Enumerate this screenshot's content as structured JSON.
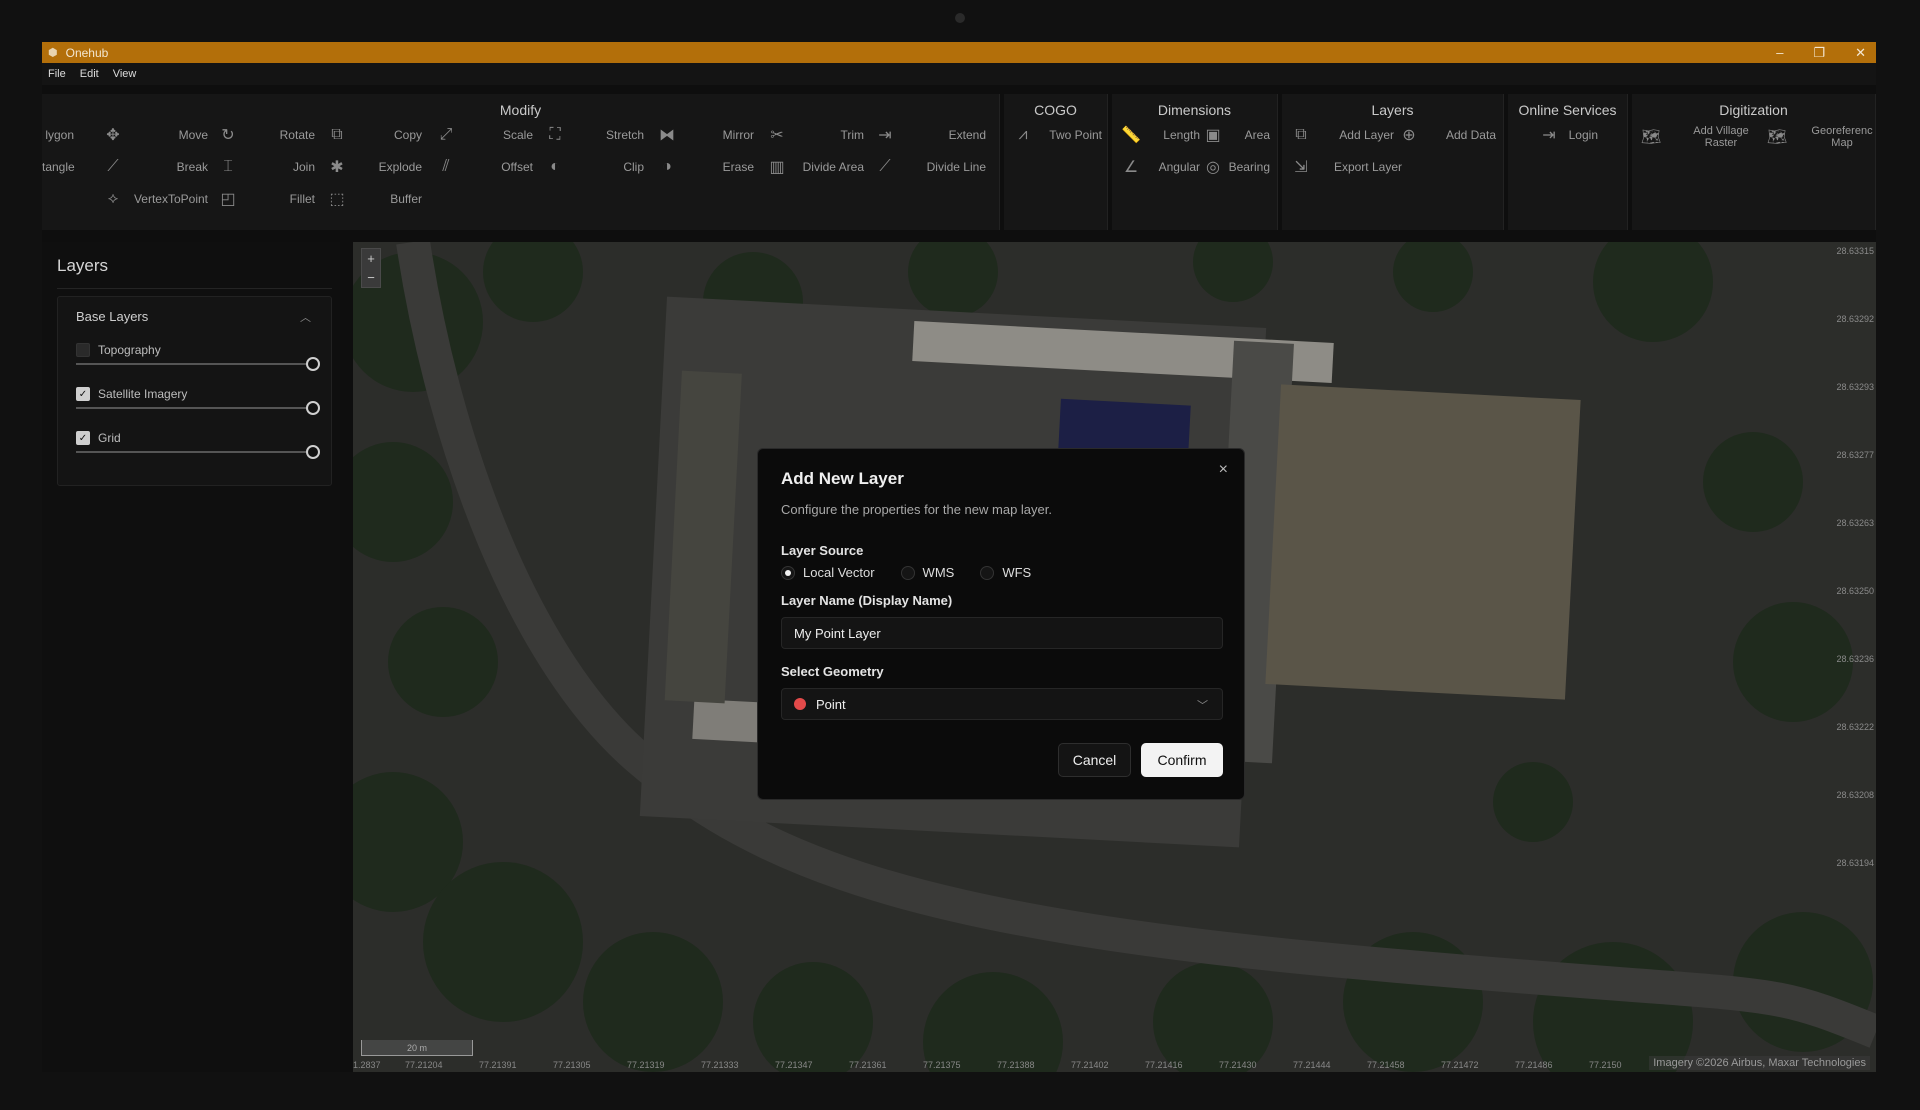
{
  "app": {
    "title": "Onehub"
  },
  "menu": [
    "File",
    "Edit",
    "View"
  ],
  "ribbon": {
    "modify": {
      "title": "Modify",
      "tools": [
        {
          "label": "lygon",
          "icon": "polygon-icon"
        },
        {
          "label": "tangle",
          "icon": "rectangle-icon"
        },
        {
          "label": "Move",
          "icon": "move-icon"
        },
        {
          "label": "Rotate",
          "icon": "rotate-icon"
        },
        {
          "label": "Copy",
          "icon": "copy-icon"
        },
        {
          "label": "Scale",
          "icon": "scale-icon"
        },
        {
          "label": "Stretch",
          "icon": "stretch-icon"
        },
        {
          "label": "Mirror",
          "icon": "mirror-icon"
        },
        {
          "label": "Trim",
          "icon": "scissors-icon"
        },
        {
          "label": "Extend",
          "icon": "extend-icon"
        },
        {
          "label": "Break",
          "icon": "break-icon"
        },
        {
          "label": "Join",
          "icon": "join-icon"
        },
        {
          "label": "Explode",
          "icon": "explode-icon"
        },
        {
          "label": "Offset",
          "icon": "offset-icon"
        },
        {
          "label": "Clip",
          "icon": "clip-icon"
        },
        {
          "label": "Erase",
          "icon": "erase-icon"
        },
        {
          "label": "Divide Area",
          "icon": "divide-area-icon"
        },
        {
          "label": "Divide Line",
          "icon": "divide-line-icon"
        },
        {
          "label": "VertexToPoint",
          "icon": "vertex-to-point-icon"
        },
        {
          "label": "Fillet",
          "icon": "fillet-icon"
        },
        {
          "label": "Buffer",
          "icon": "buffer-icon"
        }
      ]
    },
    "cogo": {
      "title": "COGO",
      "tools": [
        {
          "label": "Two Point",
          "icon": "two-point-icon"
        }
      ]
    },
    "dimensions": {
      "title": "Dimensions",
      "tools": [
        {
          "label": "Length",
          "icon": "ruler-icon"
        },
        {
          "label": "Area",
          "icon": "area-icon"
        },
        {
          "label": "Angular",
          "icon": "angle-icon"
        },
        {
          "label": "Bearing",
          "icon": "compass-icon"
        }
      ]
    },
    "layers": {
      "title": "Layers",
      "tools": [
        {
          "label": "Add Layer",
          "icon": "add-layer-icon"
        },
        {
          "label": "Add Data",
          "icon": "add-data-icon"
        },
        {
          "label": "Export Layer",
          "icon": "export-icon"
        }
      ]
    },
    "online": {
      "title": "Online Services",
      "tools": [
        {
          "label": "Login",
          "icon": "login-icon"
        }
      ]
    },
    "digitization": {
      "title": "Digitization",
      "tools": [
        {
          "label": "Add Village Raster",
          "icon": "map-icon"
        },
        {
          "label": "Georeferenc Map",
          "icon": "georeference-icon"
        }
      ]
    }
  },
  "layers_panel": {
    "title": "Layers",
    "section": "Base Layers",
    "items": [
      {
        "label": "Topography",
        "checked": false,
        "opacity": 1.0
      },
      {
        "label": "Satellite Imagery",
        "checked": true,
        "opacity": 1.0
      },
      {
        "label": "Grid",
        "checked": true,
        "opacity": 1.0
      }
    ]
  },
  "map": {
    "zoom_in": "+",
    "zoom_out": "−",
    "latitudes": [
      "28.63315",
      "28.63292",
      "28.63293",
      "28.63277",
      "28.63263",
      "28.63250",
      "28.63236",
      "28.63222",
      "28.63208",
      "28.63194"
    ],
    "longitudes": [
      "1.2837",
      "77.21204",
      "77.21391",
      "77.21305",
      "77.21319",
      "77.21333",
      "77.21347",
      "77.21361",
      "77.21375",
      "77.21388",
      "77.21402",
      "77.21416",
      "77.21430",
      "77.21444",
      "77.21458",
      "77.21472",
      "77.21486",
      "77.2150"
    ],
    "scale_label": "20 m",
    "attribution": "Imagery ©2026 Airbus, Maxar Technologies"
  },
  "dialog": {
    "title": "Add New Layer",
    "subtitle": "Configure the properties for the new map layer.",
    "source_label": "Layer Source",
    "sources": [
      {
        "label": "Local Vector",
        "selected": true
      },
      {
        "label": "WMS",
        "selected": false
      },
      {
        "label": "WFS",
        "selected": false
      }
    ],
    "name_label": "Layer Name (Display Name)",
    "name_value": "My Point Layer",
    "geometry_label": "Select Geometry",
    "geometry_value": "Point",
    "geometry_color": "#e34a4a",
    "cancel": "Cancel",
    "confirm": "Confirm",
    "close": "×"
  },
  "colors": {
    "titlebar": "#b36f0a",
    "accent_point": "#e34a4a"
  }
}
